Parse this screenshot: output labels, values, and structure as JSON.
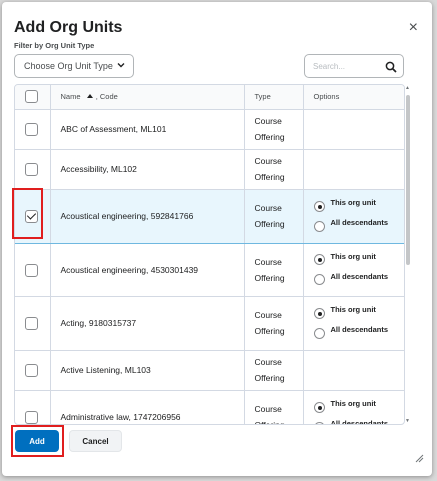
{
  "dialog": {
    "title": "Add Org Units",
    "close_glyph": "×"
  },
  "filter": {
    "label": "Filter by Org Unit Type",
    "select_value": "Choose Org Unit Type",
    "search_placeholder": "Search..."
  },
  "table": {
    "columns": {
      "name": "Name",
      "sort_suffix": ", Code",
      "type": "Type",
      "options": "Options"
    },
    "radio_labels": {
      "this_org_unit": "This org unit",
      "all_descendants": "All descendants"
    },
    "type_line1": "Course",
    "type_line2": "Offering",
    "rows": [
      {
        "name": "ABC of Assessment, ML101",
        "checked": false,
        "has_options": false
      },
      {
        "name": "Accessibility, ML102",
        "checked": false,
        "has_options": false
      },
      {
        "name": "Acoustical engineering, 592841766",
        "checked": true,
        "has_options": true
      },
      {
        "name": "Acoustical engineering, 4530301439",
        "checked": false,
        "has_options": true
      },
      {
        "name": "Acting, 9180315737",
        "checked": false,
        "has_options": true
      },
      {
        "name": "Active Listening, ML103",
        "checked": false,
        "has_options": false
      },
      {
        "name": "Administrative law, 1747206956",
        "checked": false,
        "has_options": true
      }
    ]
  },
  "footer": {
    "add_label": "Add",
    "cancel_label": "Cancel"
  },
  "colors": {
    "primary": "#006fbf",
    "highlight": "#e01e1e",
    "selected_row": "#e8f6fd"
  },
  "icons": [
    "close-icon",
    "chevron-down-icon",
    "search-icon",
    "sort-ascending-icon",
    "resize-handle-icon"
  ]
}
